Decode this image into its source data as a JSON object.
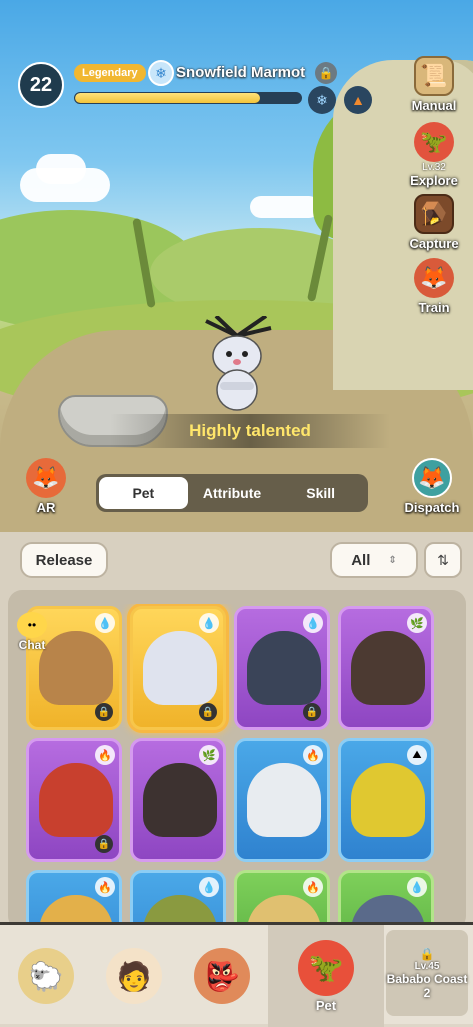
{
  "header": {
    "player_level": "22",
    "rarity": "Legendary",
    "pet_name": "Snowfield Marmot",
    "xp_progress_percent": 82,
    "traits": [
      "snowflake-icon",
      "fire-terrain-icon"
    ]
  },
  "side_menu": {
    "manual": "Manual",
    "explore": "Explore",
    "explore_level": "Lv.32",
    "capture": "Capture",
    "train": "Train",
    "ar": "AR",
    "dispatch": "Dispatch"
  },
  "talent_text": "Highly talented",
  "tabs": [
    "Pet",
    "Attribute",
    "Skill"
  ],
  "active_tab": "Pet",
  "toolbar": {
    "release_label": "Release",
    "filter_value": "All",
    "sort_icon": "sort-icon"
  },
  "chat_label": "Chat",
  "pets": [
    {
      "rarity": "gold",
      "color": "#b8844a",
      "element": "water-icon",
      "locked": true
    },
    {
      "rarity": "gold",
      "color": "#dfe3ee",
      "element": "water-icon",
      "locked": true,
      "selected": true
    },
    {
      "rarity": "purple",
      "color": "#3a4458",
      "element": "water-icon",
      "locked": true
    },
    {
      "rarity": "purple",
      "color": "#4c3a32",
      "element": "leaf-icon",
      "locked": false
    },
    {
      "rarity": "purple",
      "color": "#c8402e",
      "element": "fire-icon",
      "locked": true
    },
    {
      "rarity": "purple",
      "color": "#3d3230",
      "element": "leaf-icon",
      "locked": false
    },
    {
      "rarity": "blue",
      "color": "#e8ecf0",
      "element": "fire-icon",
      "locked": false
    },
    {
      "rarity": "blue",
      "color": "#e0c830",
      "element": "earth-icon",
      "locked": false
    },
    {
      "rarity": "blue",
      "color": "#e3b04a",
      "element": "fire-icon",
      "locked": false
    },
    {
      "rarity": "blue",
      "color": "#8a9a40",
      "element": "water-icon",
      "locked": false
    },
    {
      "rarity": "green",
      "color": "#e0c070",
      "element": "fire-icon",
      "locked": false
    },
    {
      "rarity": "green",
      "color": "#5a6a8a",
      "element": "water-icon",
      "locked": false
    }
  ],
  "bottom_nav": {
    "active_label": "Pet",
    "locked_stage_level": "Lv.45",
    "locked_stage_name": "Bababo Coast 2"
  }
}
